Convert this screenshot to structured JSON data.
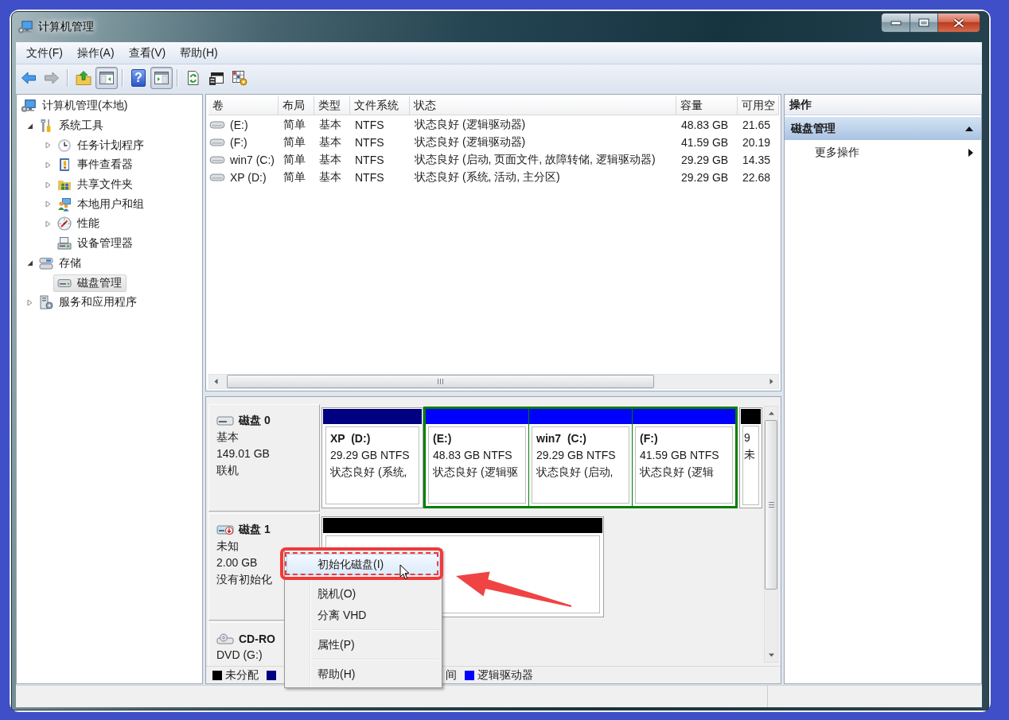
{
  "window": {
    "title": "计算机管理"
  },
  "menu_bar": [
    "文件(F)",
    "操作(A)",
    "查看(V)",
    "帮助(H)"
  ],
  "toolbar": [
    {
      "kind": "back",
      "disabled": false,
      "pressed": false
    },
    {
      "kind": "forward",
      "disabled": true,
      "pressed": false
    },
    {
      "kind": "separator"
    },
    {
      "kind": "up",
      "disabled": false,
      "pressed": false
    },
    {
      "kind": "tree",
      "disabled": false,
      "pressed": true
    },
    {
      "kind": "separator"
    },
    {
      "kind": "help",
      "glyph": "?",
      "disabled": false,
      "pressed": false
    },
    {
      "kind": "pane",
      "disabled": false,
      "pressed": true
    },
    {
      "kind": "separator"
    },
    {
      "kind": "refresh",
      "disabled": false,
      "pressed": false
    },
    {
      "kind": "properties",
      "disabled": false,
      "pressed": false
    },
    {
      "kind": "options",
      "disabled": false,
      "pressed": false
    }
  ],
  "tree": [
    {
      "label": "计算机管理(本地)",
      "kind": "computer",
      "selected": false,
      "children": [
        {
          "label": "系统工具",
          "kind": "tools",
          "expanded": true,
          "selected": false,
          "children": [
            {
              "label": "任务计划程序",
              "kind": "scheduler",
              "expanded": false,
              "selected": false
            },
            {
              "label": "事件查看器",
              "kind": "events",
              "expanded": false,
              "selected": false
            },
            {
              "label": "共享文件夹",
              "kind": "shares",
              "expanded": false,
              "selected": false
            },
            {
              "label": "本地用户和组",
              "kind": "users",
              "expanded": false,
              "selected": false
            },
            {
              "label": "性能",
              "kind": "performance",
              "expanded": false,
              "selected": false
            },
            {
              "label": "设备管理器",
              "kind": "devices",
              "selected": false
            }
          ]
        },
        {
          "label": "存储",
          "kind": "storage",
          "expanded": true,
          "selected": false,
          "children": [
            {
              "label": "磁盘管理",
              "kind": "disks",
              "selected": true
            }
          ]
        },
        {
          "label": "服务和应用程序",
          "kind": "services",
          "expanded": false,
          "selected": false
        }
      ]
    }
  ],
  "table": {
    "columns": [
      "卷",
      "布局",
      "类型",
      "文件系统",
      "状态",
      "容量",
      "可用空"
    ],
    "rows": [
      {
        "cells": [
          "(E:)",
          "简单",
          "基本",
          "NTFS",
          "状态良好 (逻辑驱动器)",
          "48.83 GB",
          "21.65"
        ]
      },
      {
        "cells": [
          "(F:)",
          "简单",
          "基本",
          "NTFS",
          "状态良好 (逻辑驱动器)",
          "41.59 GB",
          "20.19"
        ]
      },
      {
        "cells": [
          "win7 (C:)",
          "简单",
          "基本",
          "NTFS",
          "状态良好 (启动, 页面文件, 故障转储, 逻辑驱动器)",
          "29.29 GB",
          "14.35"
        ]
      },
      {
        "cells": [
          "XP (D:)",
          "简单",
          "基本",
          "NTFS",
          "状态良好 (系统, 活动, 主分区)",
          "29.29 GB",
          "22.68"
        ]
      }
    ]
  },
  "disks": [
    {
      "kind": "basic",
      "name": "磁盘 0",
      "lines": [
        "基本",
        "149.01 GB",
        "联机"
      ],
      "partitions": [
        {
          "kind": "volume",
          "color": "#000080",
          "title": "XP  (D:)",
          "lines": [
            "29.29 GB NTFS",
            "状态良好 (系统,"
          ]
        },
        {
          "kind": "extended",
          "color": "#008000",
          "partitions": [
            {
              "kind": "volume",
              "color": "#0000ff",
              "title": "(E:)",
              "lines": [
                "48.83 GB NTFS",
                "状态良好 (逻辑驱"
              ]
            },
            {
              "kind": "volume",
              "color": "#0000ff",
              "title": "win7  (C:)",
              "lines": [
                "29.29 GB NTFS",
                "状态良好 (启动,"
              ]
            },
            {
              "kind": "volume",
              "color": "#0000ff",
              "title": "(F:)",
              "lines": [
                "41.59 GB NTFS",
                "状态良好 (逻辑"
              ]
            }
          ]
        },
        {
          "kind": "volume",
          "color": "#000000",
          "lines": [
            "9",
            "未"
          ]
        }
      ]
    },
    {
      "kind": "uninitialized",
      "name": "磁盘 1",
      "lines": [
        "未知",
        "2.00 GB",
        "没有初始化"
      ],
      "partitions": [
        {
          "kind": "volume",
          "color": "#000000"
        }
      ]
    },
    {
      "kind": "cdrom",
      "name": "CD-RO",
      "lines": [
        "DVD (G:)"
      ]
    }
  ],
  "legend": [
    {
      "kind": "entry",
      "color": "#000000",
      "label": "未分配"
    },
    {
      "kind": "swatch",
      "color": "#000080"
    },
    {
      "kind": "fragment",
      "label": "间"
    },
    {
      "kind": "entry",
      "color": "#0000ff",
      "label": "逻辑驱动器"
    }
  ],
  "actions": {
    "title": "操作",
    "sections": [
      {
        "label": "磁盘管理",
        "expanded": true,
        "items": [
          {
            "label": "更多操作",
            "submenu": true
          }
        ]
      }
    ]
  },
  "context_menu": [
    {
      "kind": "item",
      "label": "初始化磁盘(I)",
      "selected": true
    },
    {
      "kind": "separator"
    },
    {
      "kind": "item",
      "label": "脱机(O)",
      "selected": false
    },
    {
      "kind": "item",
      "label": "分离 VHD",
      "selected": false
    },
    {
      "kind": "separator"
    },
    {
      "kind": "item",
      "label": "属性(P)",
      "selected": false
    },
    {
      "kind": "separator"
    },
    {
      "kind": "item",
      "label": "帮助(H)",
      "selected": false
    }
  ],
  "annotations": {
    "highlight_frame": true,
    "arrow": true
  },
  "mouse_pointer": true
}
